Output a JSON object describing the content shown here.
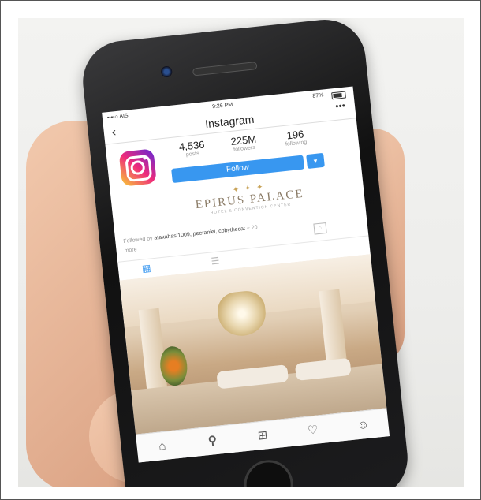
{
  "status": {
    "carrier": "••••○ AIS",
    "time": "9:26 PM",
    "battery": "87%"
  },
  "nav": {
    "title": "Instagram",
    "back": "‹",
    "more": "•••"
  },
  "profile": {
    "stats": [
      {
        "value": "4,536",
        "label": "posts"
      },
      {
        "value": "225M",
        "label": "followers"
      },
      {
        "value": "196",
        "label": "following"
      }
    ],
    "follow_label": "Follow",
    "dropdown_glyph": "▾"
  },
  "brand": {
    "crest": "✦ ✦ ✦",
    "name": "EPIRUS PALACE",
    "sub": "HOTEL & CONVENTION CENTER"
  },
  "followed_by": {
    "prefix": "Followed by ",
    "names": "atakahasi1009, peeraniei, cobythecat",
    "suffix": " + 20",
    "more": "more"
  },
  "icons": {
    "grid": "grid-icon",
    "list": "list-icon",
    "tagged": "tagged-icon"
  },
  "tabbar": [
    "home-icon",
    "search-icon",
    "add-icon",
    "heart-icon",
    "profile-icon"
  ],
  "colors": {
    "follow_blue": "#3897f0"
  }
}
